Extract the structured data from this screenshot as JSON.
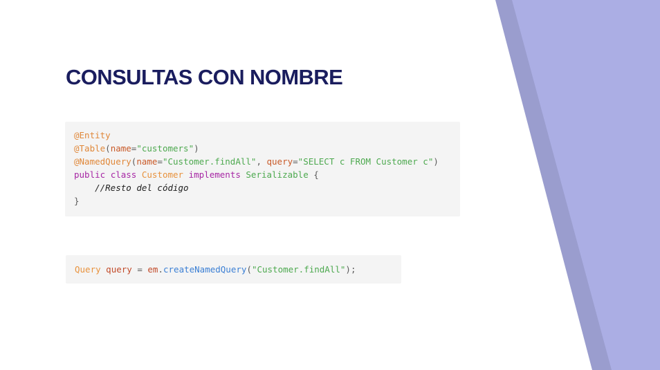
{
  "slide": {
    "title": "CONSULTAS CON NOMBRE"
  },
  "code_block_1": {
    "line1": {
      "annotation": "@Entity"
    },
    "line2": {
      "annotation": "@Table",
      "open": "(",
      "attr": "name",
      "eq": "=",
      "value": "\"customers\"",
      "close": ")"
    },
    "line3": {
      "annotation": "@NamedQuery",
      "open": "(",
      "attr1": "name",
      "eq1": "=",
      "value1": "\"Customer.findAll\"",
      "comma": ", ",
      "attr2": "query",
      "eq2": "=",
      "value2": "\"SELECT c FROM Customer c\"",
      "close": ")"
    },
    "line4": {
      "kw_public": "public",
      "kw_class": "class",
      "class_name": "Customer",
      "kw_implements": "implements",
      "interface": "Serializable",
      "brace": "{"
    },
    "line5": {
      "indent": "    ",
      "comment": "//Resto del código"
    },
    "line6": {
      "brace": "}"
    }
  },
  "code_block_2": {
    "type": "Query",
    "var": "query",
    "assign": "=",
    "obj": "em",
    "dot": ".",
    "method": "createNamedQuery",
    "open": "(",
    "arg": "\"Customer.findAll\"",
    "close": ");"
  },
  "colors": {
    "title": "#1a1d5e",
    "decor_dark": "#9a9dce",
    "decor_light": "#abaee4",
    "code_background": "#f4f4f4"
  }
}
